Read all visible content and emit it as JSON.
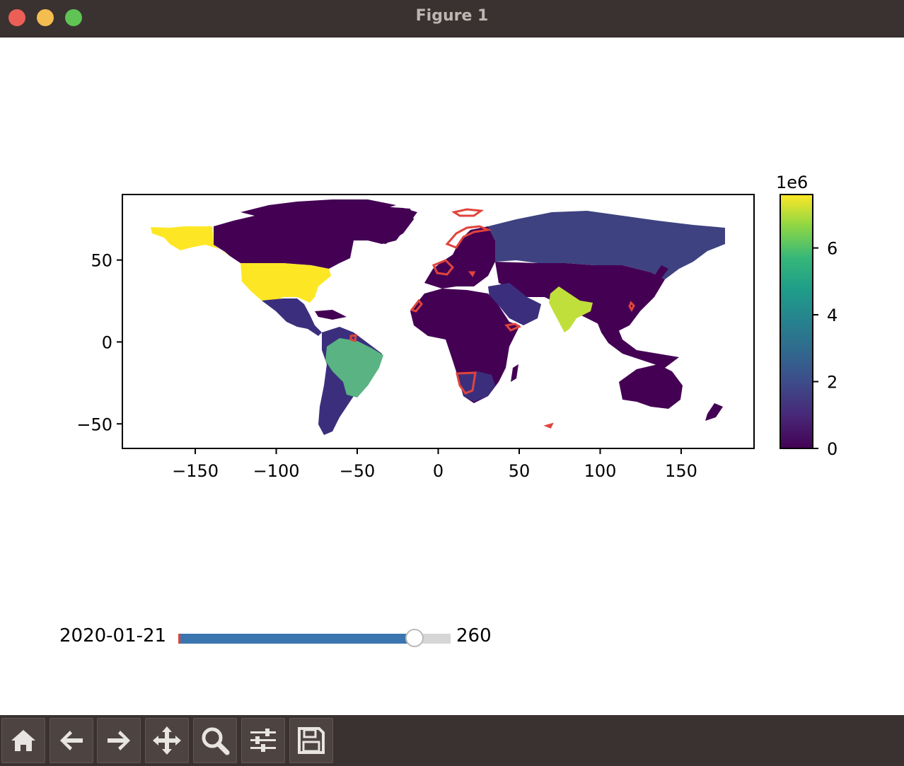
{
  "window": {
    "title": "Figure 1"
  },
  "chart_data": {
    "type": "heatmap",
    "subtype": "choropleth-map",
    "xticks": [
      "−150",
      "−100",
      "−50",
      "0",
      "50",
      "100",
      "150"
    ],
    "yticks": [
      "50",
      "0",
      "−50"
    ],
    "xlim": [
      -195,
      195
    ],
    "ylim": [
      -65,
      90
    ],
    "colorbar": {
      "colormap": "viridis",
      "range": [
        0,
        7.6
      ],
      "multiplier_label": "1e6",
      "ticks": [
        "0",
        "2",
        "4",
        "6"
      ],
      "tick_values": [
        0,
        2,
        4,
        6
      ]
    },
    "highlight_outline_color": "#e0443c",
    "colors": {
      "low": "#440154",
      "low2": "#3b2f7d",
      "mid": "#5ab382",
      "high": "#fde725",
      "india": "#c1df3a"
    }
  },
  "slider": {
    "label": "2020-01-21",
    "value_text": "260",
    "fraction": 0.866,
    "fill_color": "#3b75af",
    "track_color": "#d6d6d6"
  },
  "toolbar": {
    "buttons": [
      {
        "name": "home-button",
        "icon": "home-icon"
      },
      {
        "name": "back-button",
        "icon": "arrow-left-icon"
      },
      {
        "name": "forward-button",
        "icon": "arrow-right-icon"
      },
      {
        "name": "pan-button",
        "icon": "move-icon"
      },
      {
        "name": "zoom-button",
        "icon": "magnifier-icon"
      },
      {
        "name": "subplots-button",
        "icon": "sliders-icon"
      },
      {
        "name": "save-button",
        "icon": "floppy-icon"
      }
    ]
  }
}
